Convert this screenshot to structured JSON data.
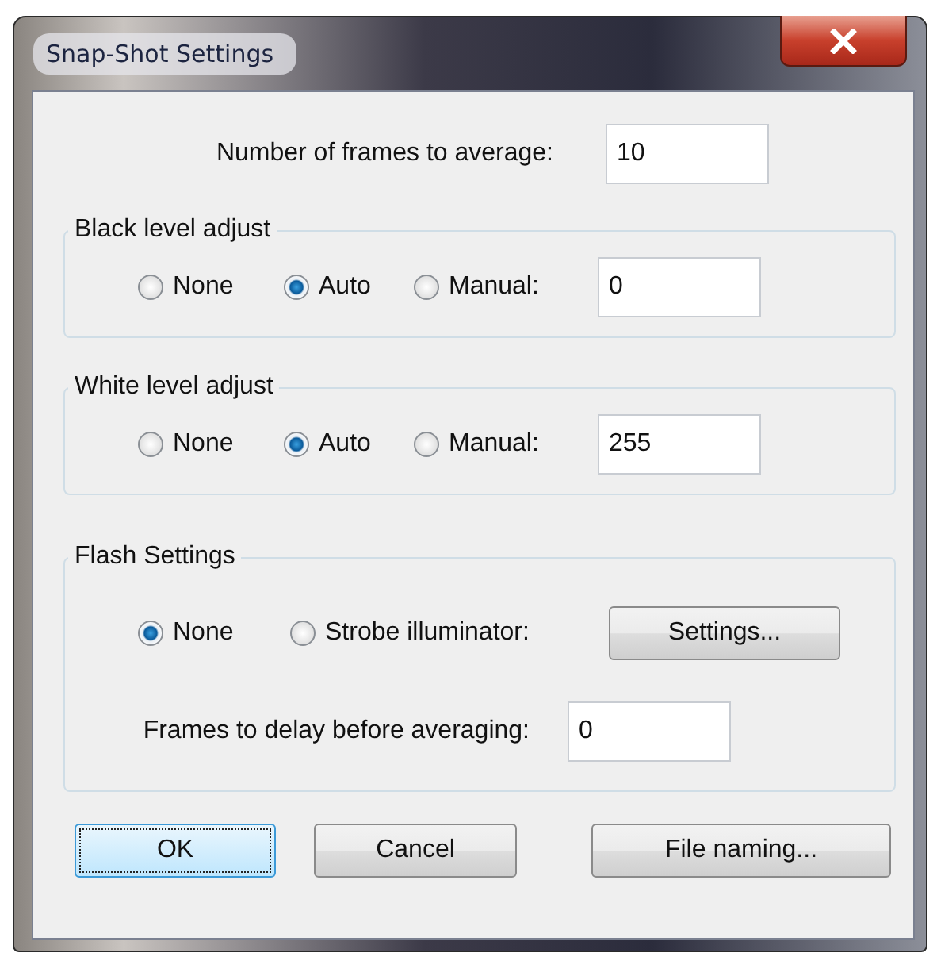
{
  "window": {
    "title": "Snap-Shot Settings"
  },
  "frames_to_average": {
    "label": "Number of frames to average:",
    "value": "10"
  },
  "groups": [
    {
      "kind": "level",
      "title": "Black level adjust",
      "options": [
        {
          "label": "None",
          "selected": false
        },
        {
          "label": "Auto",
          "selected": true
        },
        {
          "label": "Manual:",
          "selected": false
        }
      ],
      "manual_value": "0"
    },
    {
      "kind": "level",
      "title": "White level adjust",
      "options": [
        {
          "label": "None",
          "selected": false
        },
        {
          "label": "Auto",
          "selected": true
        },
        {
          "label": "Manual:",
          "selected": false
        }
      ],
      "manual_value": "255"
    },
    {
      "kind": "flash",
      "title": "Flash Settings",
      "options": [
        {
          "label": "None",
          "selected": true
        },
        {
          "label": "Strobe illuminator:",
          "selected": false
        }
      ],
      "settings_button": "Settings...",
      "delay_label": "Frames to delay before averaging:",
      "delay_value": "0"
    }
  ],
  "buttons": [
    {
      "label": "OK",
      "default": true
    },
    {
      "label": "Cancel",
      "default": false
    },
    {
      "label": "File naming...",
      "default": false
    }
  ]
}
